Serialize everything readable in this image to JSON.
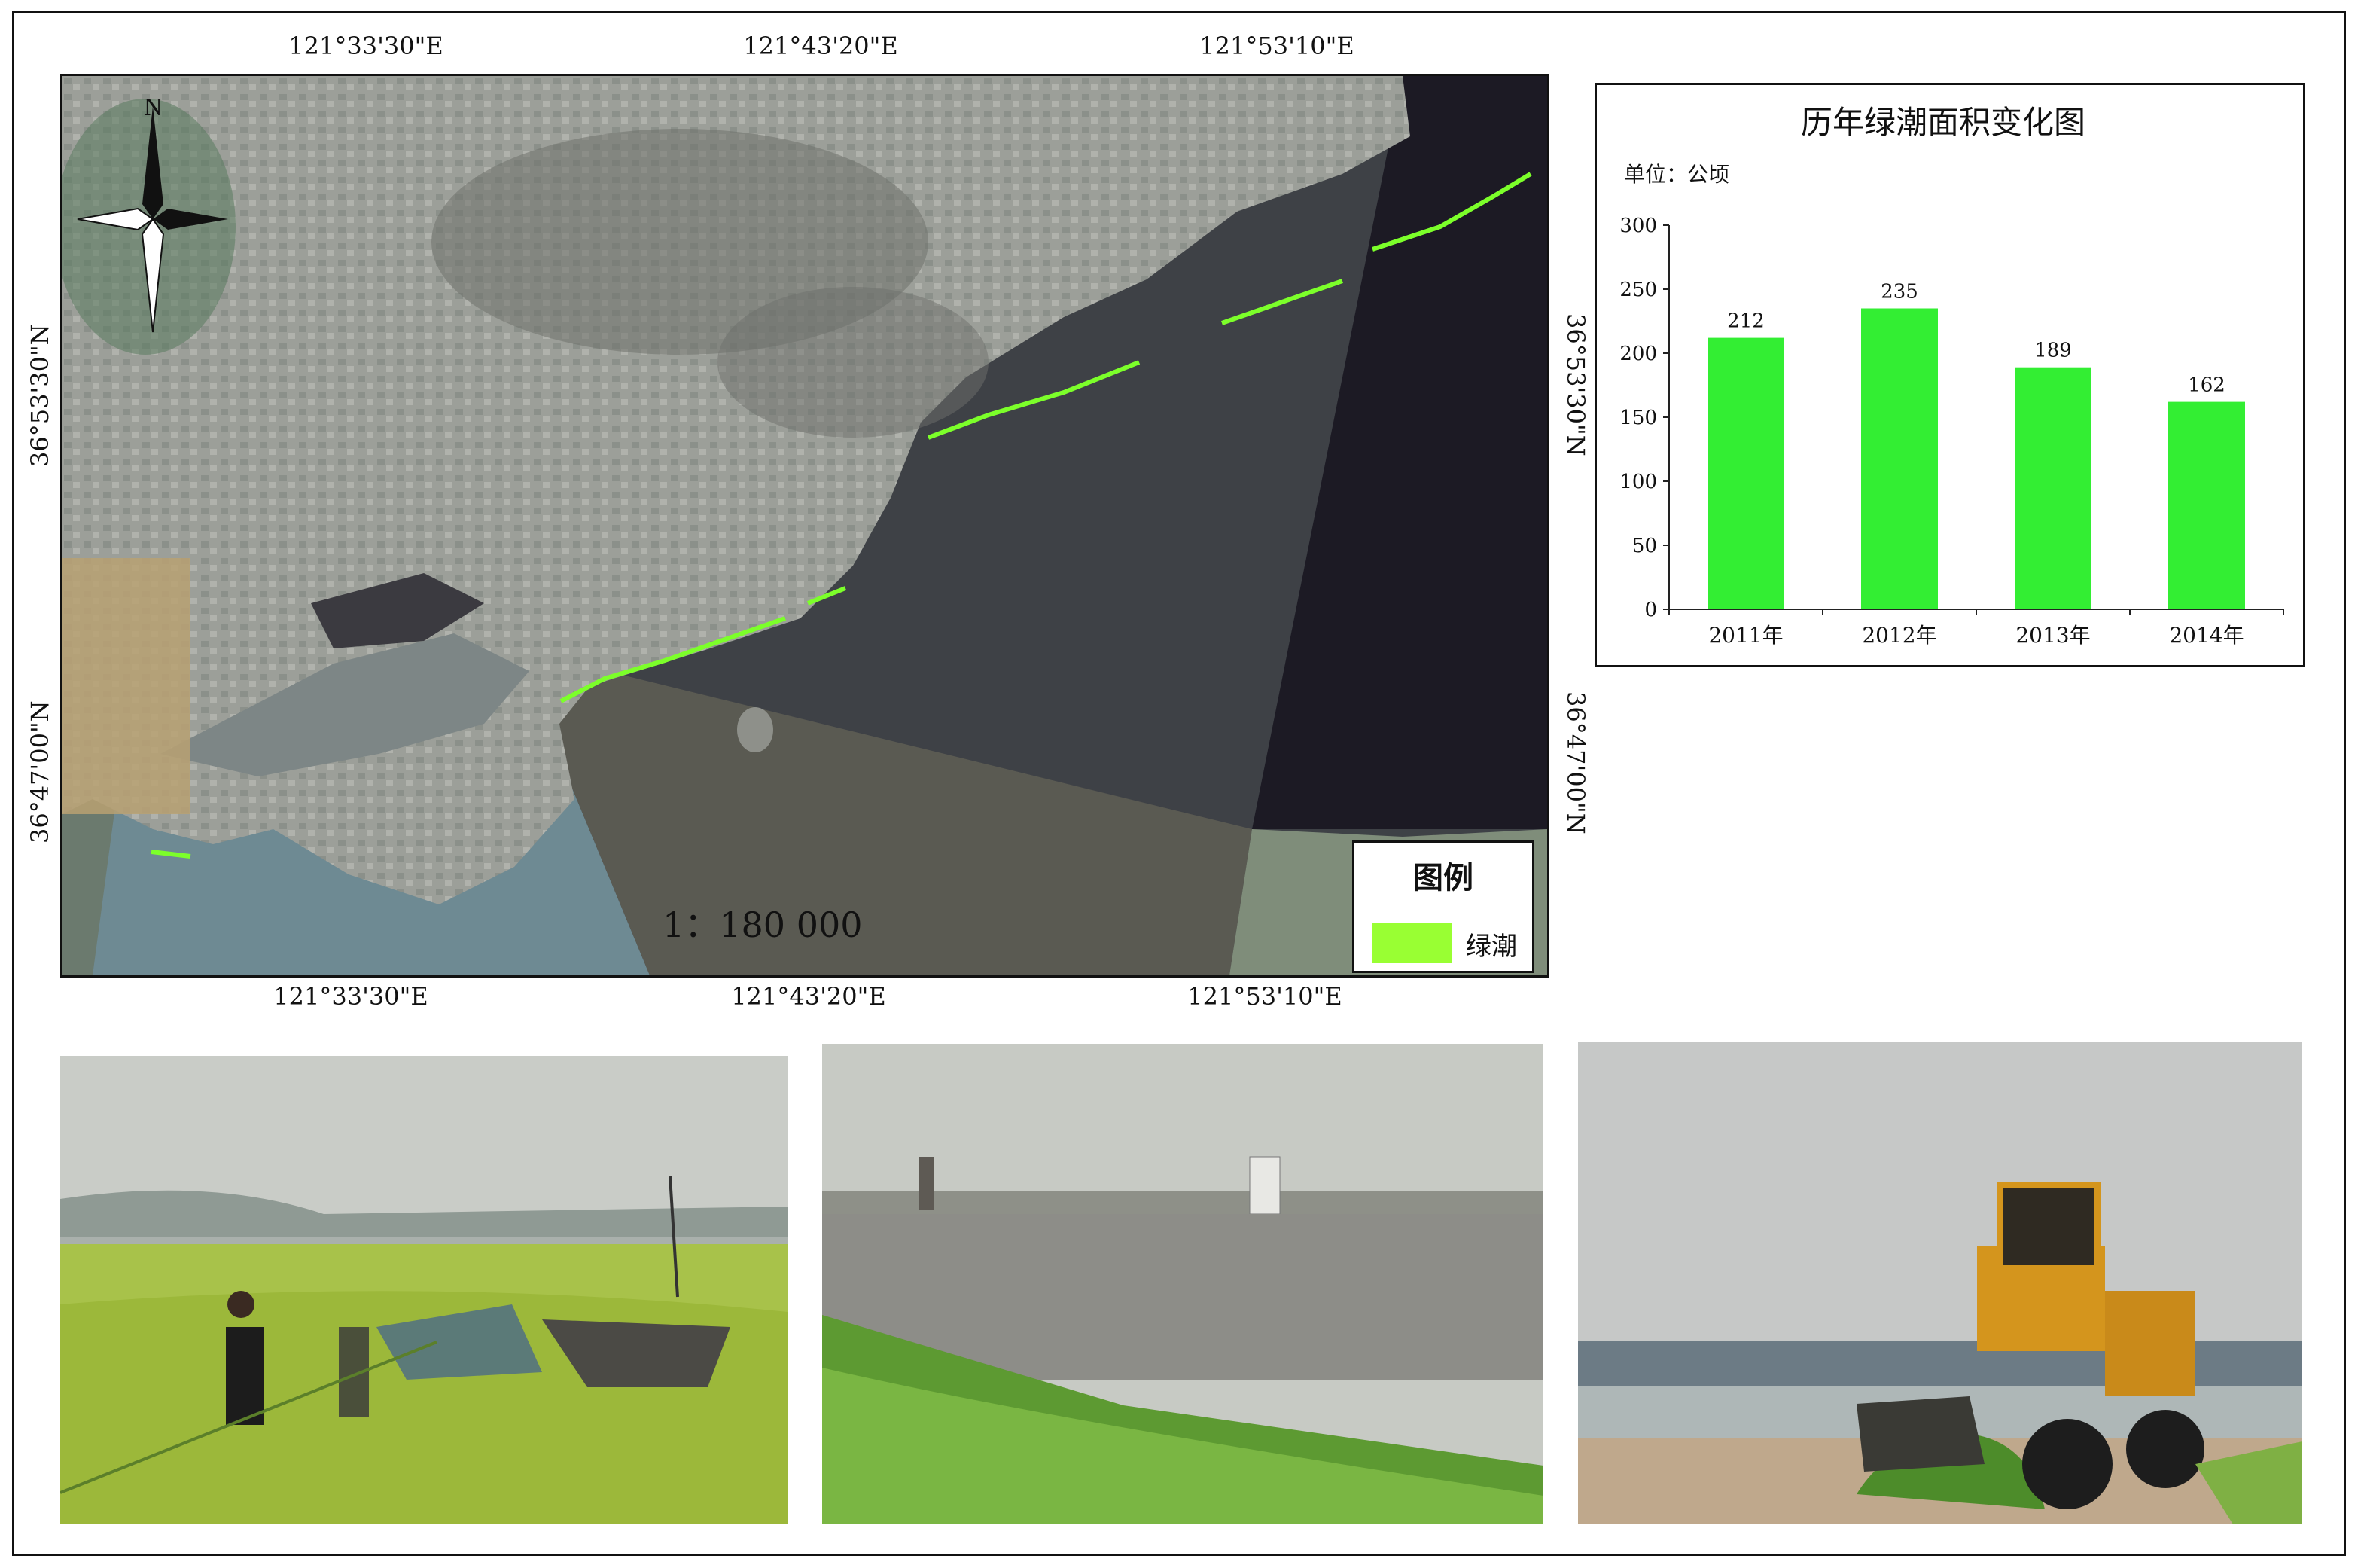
{
  "map": {
    "top_labels": [
      "121°33'30\"E",
      "121°43'20\"E",
      "121°53'10\"E"
    ],
    "bottom_labels": [
      "121°33'30\"E",
      "121°43'20\"E",
      "121°53'10\"E"
    ],
    "left_labels": [
      "36°53'30\"N",
      "36°47'00\"N"
    ],
    "right_labels": [
      "36°53'30\"N",
      "36°47'00\"N"
    ],
    "north_label": "N",
    "scale": "1：180 000",
    "legend_title": "图例",
    "legend_item": "绿潮",
    "legend_color": "#99ff33",
    "algae_color": "#7cff2a"
  },
  "chart_data": {
    "type": "bar",
    "title": "历年绿潮面积变化图",
    "unit_label": "单位：公顷",
    "categories": [
      "2011年",
      "2012年",
      "2013年",
      "2014年"
    ],
    "values": [
      212,
      235,
      189,
      162
    ],
    "ylim": [
      0,
      300
    ],
    "yticks": [
      0,
      50,
      100,
      150,
      200,
      250,
      300
    ],
    "bar_color": "#33ee33",
    "grid": false,
    "legend": "none"
  },
  "photos": [
    {
      "name": "photo-fishermen"
    },
    {
      "name": "photo-shore"
    },
    {
      "name": "photo-loader"
    }
  ]
}
